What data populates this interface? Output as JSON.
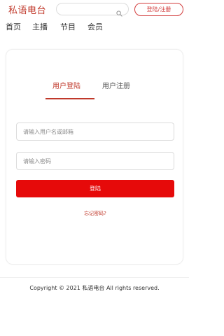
{
  "header": {
    "logo": "私语电台",
    "search_placeholder": "",
    "login_register": "登陆/注册"
  },
  "nav": {
    "items": [
      "首页",
      "主播",
      "节目",
      "会员"
    ]
  },
  "auth": {
    "tabs": [
      "用户登陆",
      "用户注册"
    ],
    "active_tab": "用户登陆",
    "username_placeholder": "请输入用户名或邮箱",
    "password_placeholder": "请输入密码",
    "submit_label": "登陆",
    "forgot_label": "忘记密码?"
  },
  "footer": {
    "copyright": "Copyright © 2021 私语电台 All rights reserved."
  },
  "colors": {
    "accent": "#c0392b",
    "primary_button": "#e60a0a"
  },
  "icons": {
    "search": "search-icon"
  }
}
